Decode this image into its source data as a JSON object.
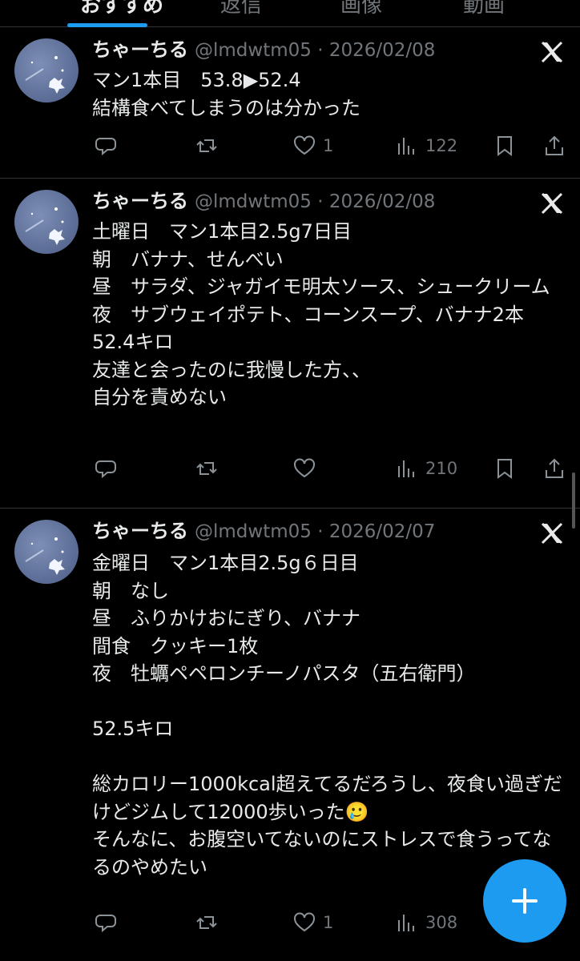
{
  "tabs": [
    {
      "label": "おすすめ",
      "active": true
    },
    {
      "label": "返信",
      "active": false
    },
    {
      "label": "画像",
      "active": false
    },
    {
      "label": "動画",
      "active": false
    }
  ],
  "posts": [
    {
      "name": "ちゃーちる",
      "meta": "@lmdwtm05 · 2026/02/08",
      "text": "マン1本目　53.8▶52.4\n結構食べてしまうのは分かった",
      "reply_count": "",
      "repost_count": "",
      "like_count": "1",
      "view_count": "122"
    },
    {
      "name": "ちゃーちる",
      "meta": "@lmdwtm05 · 2026/02/08",
      "text": "土曜日　マン1本目2.5g7日目\n朝　バナナ、せんべい\n昼　サラダ、ジャガイモ明太ソース、シュークリーム\n夜　サブウェイポテト、コーンスープ、バナナ2本\n52.4キロ\n友達と会ったのに我慢した方、、\n自分を責めない",
      "reply_count": "",
      "repost_count": "",
      "like_count": "",
      "view_count": "210"
    },
    {
      "name": "ちゃーちる",
      "meta": "@lmdwtm05 · 2026/02/07",
      "text": "金曜日　マン1本目2.5g６日目\n朝　なし\n昼　ふりかけおにぎり、バナナ\n間食　クッキー1枚\n夜　牡蠣ペペロンチーノパスタ（五右衛門）\n\n52.5キロ\n\n総カロリー1000kcal超えてるだろうし、夜食い過ぎだけどジムして12000歩いった🥲\nそんなに、お腹空いてないのにストレスで食うってなるのやめたい",
      "reply_count": "",
      "repost_count": "",
      "like_count": "1",
      "view_count": "308"
    }
  ],
  "icons": {
    "reply": "reply-icon",
    "repost": "repost-icon",
    "like": "like-icon",
    "views": "views-icon",
    "bookmark": "bookmark-icon",
    "share": "share-icon",
    "x_logo": "x-logo-icon",
    "compose": "compose-plus-icon"
  },
  "colors": {
    "background": "#000000",
    "text": "#e7e9ea",
    "secondary": "#71767b",
    "accent": "#1d9bf0"
  }
}
